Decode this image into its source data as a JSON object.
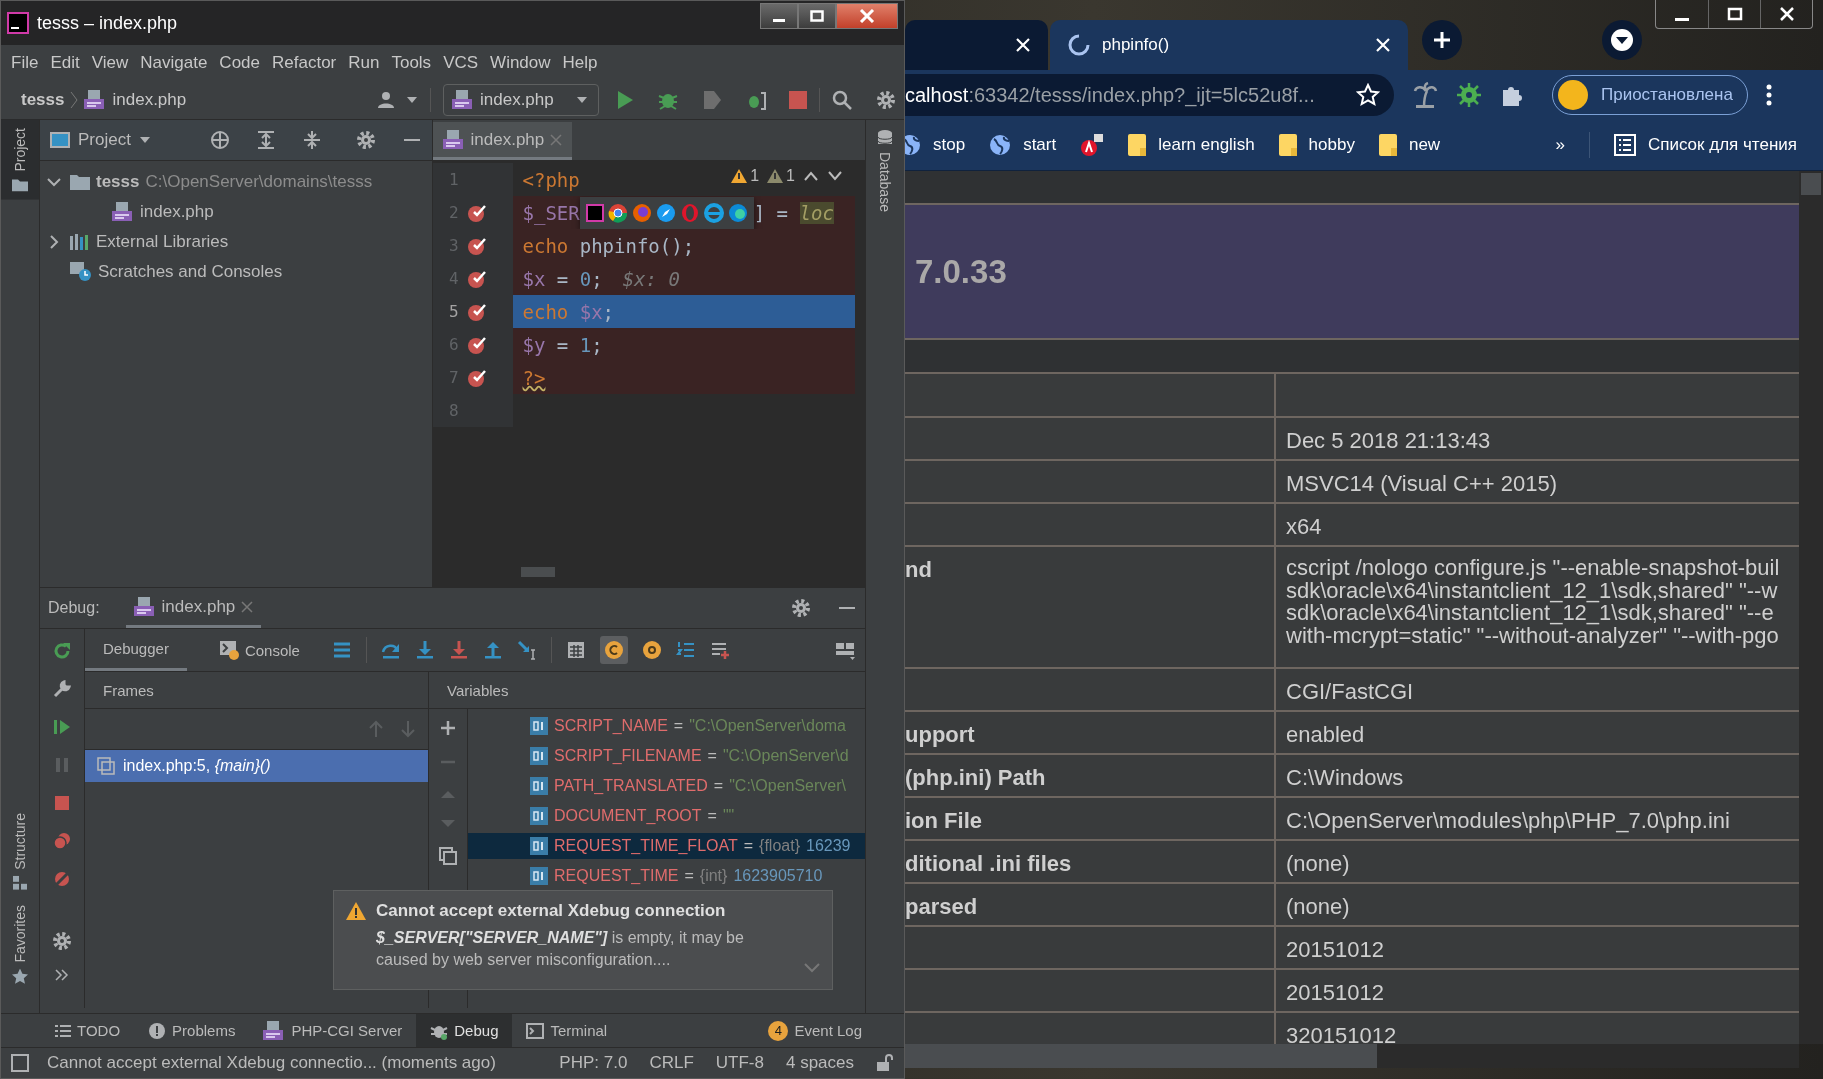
{
  "ide": {
    "title": "tesss – index.php",
    "menu": [
      "File",
      "Edit",
      "View",
      "Navigate",
      "Code",
      "Refactor",
      "Run",
      "Tools",
      "VCS",
      "Window",
      "Help"
    ],
    "breadcrumb": [
      "tesss",
      "index.php"
    ],
    "run_config": "index.php",
    "side_tabs": [
      {
        "label": "Project",
        "selected": true
      },
      {
        "label": "Structure",
        "selected": false
      },
      {
        "label": "Favorites",
        "selected": false
      }
    ],
    "project": {
      "title": "Project",
      "tree": [
        {
          "label": "tesss",
          "path": "C:\\OpenServer\\domains\\tesss",
          "kind": "folder",
          "expanded": true,
          "children": [
            {
              "label": "index.php",
              "kind": "php"
            }
          ]
        },
        {
          "label": "External Libraries",
          "kind": "libraries",
          "expanded": false
        },
        {
          "label": "Scratches and Consoles",
          "kind": "scratches"
        }
      ]
    },
    "editor": {
      "tab": "index.php",
      "warnings": [
        "1",
        "1"
      ],
      "lines": [
        {
          "number": "1",
          "breakpoint": false,
          "current": false,
          "tokens": [
            {
              "text": "<?php",
              "kind": "tag"
            }
          ]
        },
        {
          "number": "2",
          "breakpoint": true,
          "current": false,
          "tokens": [
            {
              "text": "$_SER",
              "kind": "var"
            },
            {
              "kind": "browser-popup"
            },
            {
              "text": "] = ",
              "kind": "plain"
            },
            {
              "text": "loc",
              "kind": "highlight"
            }
          ]
        },
        {
          "number": "3",
          "breakpoint": true,
          "current": false,
          "tokens": [
            {
              "text": "echo",
              "kind": "keyword"
            },
            {
              "text": " phpinfo();",
              "kind": "plain"
            }
          ]
        },
        {
          "number": "4",
          "breakpoint": true,
          "current": false,
          "tokens": [
            {
              "text": "$x",
              "kind": "var"
            },
            {
              "text": " = ",
              "kind": "plain"
            },
            {
              "text": "0",
              "kind": "number"
            },
            {
              "text": ";",
              "kind": "plain"
            },
            {
              "text": "$x: 0",
              "kind": "inline-value"
            }
          ]
        },
        {
          "number": "5",
          "breakpoint": true,
          "current": true,
          "tokens": [
            {
              "text": "echo",
              "kind": "keyword"
            },
            {
              "text": "$x",
              "kind": "var"
            },
            {
              "text": ";",
              "kind": "plain"
            }
          ]
        },
        {
          "number": "6",
          "breakpoint": true,
          "current": false,
          "tokens": [
            {
              "text": "$y",
              "kind": "var"
            },
            {
              "text": " = ",
              "kind": "plain"
            },
            {
              "text": "1",
              "kind": "number"
            },
            {
              "text": ";",
              "kind": "plain"
            }
          ]
        },
        {
          "number": "7",
          "breakpoint": true,
          "current": false,
          "tokens": [
            {
              "text": "?>",
              "kind": "tag-warn"
            }
          ]
        },
        {
          "number": "8",
          "breakpoint": false,
          "current": false
        }
      ]
    },
    "database_tab": "Database",
    "debug": {
      "label": "Debug:",
      "tab": "index.php",
      "views": [
        {
          "label": "Debugger",
          "selected": true
        },
        {
          "label": "Console",
          "selected": false
        }
      ],
      "frames_title": "Frames",
      "variables_title": "Variables",
      "frames": [
        {
          "text": "index.php:5, *{main}()*",
          "selected": true
        }
      ],
      "variables": [
        {
          "name": "SCRIPT_NAME",
          "eq": "=",
          "value": "\"C:\\OpenServer\\doma",
          "kind": "string",
          "selected": false
        },
        {
          "name": "SCRIPT_FILENAME",
          "eq": "=",
          "value": "\"C:\\OpenServer\\d",
          "kind": "string",
          "selected": false
        },
        {
          "name": "PATH_TRANSLATED",
          "eq": "=",
          "value": "\"C:\\OpenServer\\",
          "kind": "string",
          "selected": false
        },
        {
          "name": "DOCUMENT_ROOT",
          "eq": "=",
          "value": "\"\"",
          "kind": "string",
          "selected": false
        },
        {
          "name": "REQUEST_TIME_FLOAT",
          "eq": "=",
          "type": "{float}",
          "value": "16239",
          "kind": "number",
          "selected": true
        },
        {
          "name": "REQUEST_TIME",
          "eq": "=",
          "type": "{int}",
          "value": "1623905710",
          "kind": "number",
          "selected": false
        }
      ],
      "notification": {
        "title": "Cannot accept external Xdebug connection",
        "body": "**$_SERVER[\"SERVER_NAME\"]** is empty, it may be caused by web server misconfiguration...."
      }
    },
    "tool_tabs": [
      {
        "label": "TODO",
        "kind": "list",
        "selected": false
      },
      {
        "label": "Problems",
        "kind": "problems",
        "selected": false
      },
      {
        "label": "PHP-CGI Server",
        "kind": "php",
        "selected": false
      },
      {
        "label": "Debug",
        "kind": "bug",
        "selected": true
      },
      {
        "label": "Terminal",
        "kind": "terminal",
        "selected": false
      },
      {
        "label": "Event Log",
        "kind": "log",
        "badge": "4",
        "selected": false
      }
    ],
    "status_bar": {
      "message": "Cannot accept external Xdebug connectio... (moments ago)",
      "items": [
        "PHP: 7.0",
        "CRLF",
        "UTF-8",
        "4 spaces"
      ]
    }
  },
  "browser": {
    "tabs": [
      {
        "selected": false,
        "loading": false
      },
      {
        "title": "phpinfo()",
        "selected": true,
        "loading": true
      }
    ],
    "address": {
      "host": "calhost",
      "rest": ":63342/tesss/index.php?_ijt=5lc52u8f..."
    },
    "profile": "Приостановлена",
    "bookmarks": [
      {
        "label": "stop",
        "kind": "globe"
      },
      {
        "label": "start",
        "kind": "globe"
      },
      {
        "kind": "app"
      },
      {
        "label": "learn english",
        "kind": "folder"
      },
      {
        "label": "hobby",
        "kind": "folder"
      },
      {
        "label": "new",
        "kind": "folder"
      }
    ],
    "more": "»",
    "reading_list": "Список для чтения",
    "page": {
      "version": "7.0.33",
      "rows": [
        {
          "kind": "blank"
        },
        {
          "kind": "single",
          "value": "Dec 5 2018 21:13:43"
        },
        {
          "kind": "single",
          "value": "MSVC14 (Visual C++ 2015)"
        },
        {
          "kind": "single",
          "value": "x64"
        },
        {
          "kind": "multi",
          "label": "nd",
          "lines": [
            "cscript /nologo configure.js \"--enable-snapshot-buil",
            "sdk\\oracle\\x64\\instantclient_12_1\\sdk,shared\" \"--w",
            "sdk\\oracle\\x64\\instantclient_12_1\\sdk,shared\" \"--e",
            "with-mcrypt=static\" \"--without-analyzer\" \"--with-pgo"
          ]
        },
        {
          "kind": "single",
          "value": "CGI/FastCGI"
        },
        {
          "kind": "single",
          "label": "upport",
          "value": "enabled"
        },
        {
          "kind": "single",
          "label": "(php.ini) Path",
          "value": "C:\\Windows"
        },
        {
          "kind": "single",
          "label": "ion File",
          "value": "C:\\OpenServer\\modules\\php\\PHP_7.0\\php.ini"
        },
        {
          "kind": "single",
          "label": "ditional .ini files",
          "value": "(none)"
        },
        {
          "kind": "single",
          "label": "parsed",
          "value": "(none)"
        },
        {
          "kind": "single",
          "value": "20151012"
        },
        {
          "kind": "single",
          "value": "20151012"
        },
        {
          "kind": "single",
          "value": "320151012"
        }
      ]
    }
  }
}
